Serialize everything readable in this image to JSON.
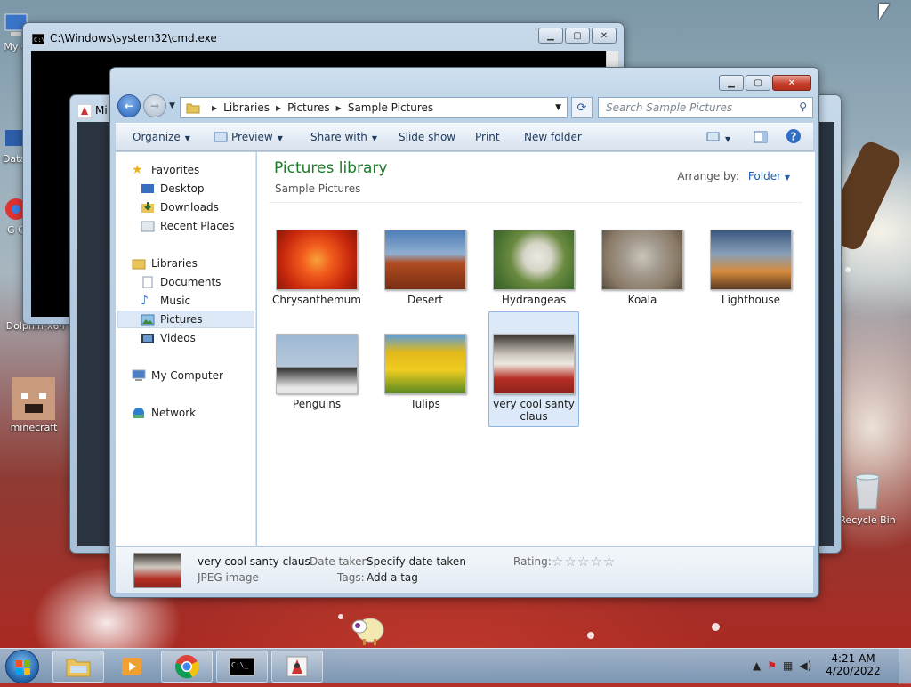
{
  "desktop": {
    "icons": [
      {
        "label": "My C",
        "id": "my-computer"
      },
      {
        "label": "Data",
        "id": "data"
      },
      {
        "label": "G\nC",
        "id": "google-chrome"
      },
      {
        "label": "Dolphin-x64",
        "id": "dolphin"
      },
      {
        "label": "minecraft",
        "id": "minecraft"
      },
      {
        "label": "Recycle Bin",
        "id": "recycle-bin"
      }
    ]
  },
  "cmd_window": {
    "title": "C:\\Windows\\system32\\cmd.exe"
  },
  "mc_window": {
    "title": "Mi"
  },
  "explorer": {
    "breadcrumbs": [
      "Libraries",
      "Pictures",
      "Sample Pictures"
    ],
    "search_placeholder": "Search Sample Pictures",
    "toolbar": {
      "organize": "Organize",
      "preview": "Preview",
      "share_with": "Share with",
      "slide_show": "Slide show",
      "print": "Print",
      "new_folder": "New folder"
    },
    "nav": {
      "favorites": "Favorites",
      "desktop": "Desktop",
      "downloads": "Downloads",
      "recent_places": "Recent Places",
      "libraries": "Libraries",
      "documents": "Documents",
      "music": "Music",
      "pictures": "Pictures",
      "videos": "Videos",
      "my_computer": "My Computer",
      "network": "Network"
    },
    "library_title": "Pictures library",
    "library_subtitle": "Sample Pictures",
    "arrange_label": "Arrange by:",
    "arrange_value": "Folder",
    "files": [
      {
        "name": "Chrysanthemum",
        "colors": [
          "#f25c1c",
          "#c5260c"
        ]
      },
      {
        "name": "Desert",
        "colors": [
          "#4f7fb8",
          "#b04c22"
        ]
      },
      {
        "name": "Hydrangeas",
        "colors": [
          "#2f5c24",
          "#d7d5c8"
        ]
      },
      {
        "name": "Koala",
        "colors": [
          "#8a7a66",
          "#c9c4bb"
        ]
      },
      {
        "name": "Lighthouse",
        "colors": [
          "#3a5880",
          "#d68a3c"
        ]
      },
      {
        "name": "Penguins",
        "colors": [
          "#9cb8d4",
          "#2c2c2c"
        ]
      },
      {
        "name": "Tulips",
        "colors": [
          "#5c9edc",
          "#e0b81a"
        ]
      },
      {
        "name": "very cool santy claus",
        "colors": [
          "#3a3530",
          "#b52e24"
        ]
      }
    ],
    "details": {
      "name": "very cool santy claus",
      "type": "JPEG image",
      "date_taken_label": "Date taken:",
      "date_taken_value": "Specify date taken",
      "tags_label": "Tags:",
      "tags_value": "Add a tag",
      "rating_label": "Rating:",
      "rating_stars": 0
    }
  },
  "taskbar": {
    "time": "4:21 AM",
    "date": "4/20/2022"
  }
}
